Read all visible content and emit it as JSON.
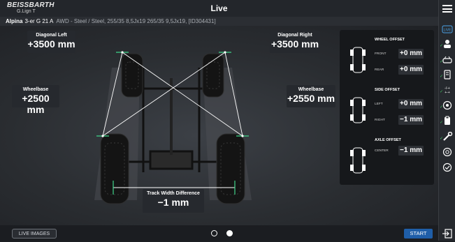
{
  "header": {
    "brand": "BEISSBARTH",
    "brand_sub": "G.Lign T",
    "title": "Live",
    "vehicle_make": "Alpina",
    "vehicle_model": "3-er G 21 A",
    "vehicle_spec": "AWD - Steel / Steel, 255/35 8,5Jx19 265/35 9,5Jx19, [ID304431]"
  },
  "measurements": {
    "diagonal_left": {
      "label": "Diagonal Left",
      "value": "+3500 mm"
    },
    "diagonal_right": {
      "label": "Diagonal Right",
      "value": "+3500 mm"
    },
    "wheelbase_left": {
      "label": "Wheelbase",
      "value": "+2500 mm"
    },
    "wheelbase_right": {
      "label": "Wheelbase",
      "value": "+2550 mm"
    },
    "track_width": {
      "label": "Track Width Difference",
      "value": "−1 mm"
    }
  },
  "offsets": {
    "wheel": {
      "title": "WHEEL OFFSET",
      "front_label": "FRONT",
      "front_value": "+0 mm",
      "rear_label": "REAR",
      "rear_value": "+0 mm"
    },
    "side": {
      "title": "SIDE OFFSET",
      "left_label": "LEFT",
      "left_value": "+0 mm",
      "right_label": "RIGHT",
      "right_value": "−1 mm"
    },
    "axle": {
      "title": "AXLE OFFSET",
      "center_label": "CENTER",
      "center_value": "−1 mm"
    }
  },
  "sidebar": {
    "live_label": "LIVE",
    "items": [
      "customer-icon",
      "vehicle-icon",
      "rim-icon",
      "settings-sliders-icon",
      "sensor-icon",
      "clipboard-icon",
      "wrench-icon",
      "brake-icon",
      "checkmark-circle-icon"
    ]
  },
  "footer": {
    "live_images_label": "LIVE IMAGES",
    "start_label": "START"
  },
  "colors": {
    "accent_blue": "#1f5ea8",
    "check_green": "#3fbf5f",
    "measure_line": "#ffffff",
    "marker_green": "#3fd68a"
  }
}
